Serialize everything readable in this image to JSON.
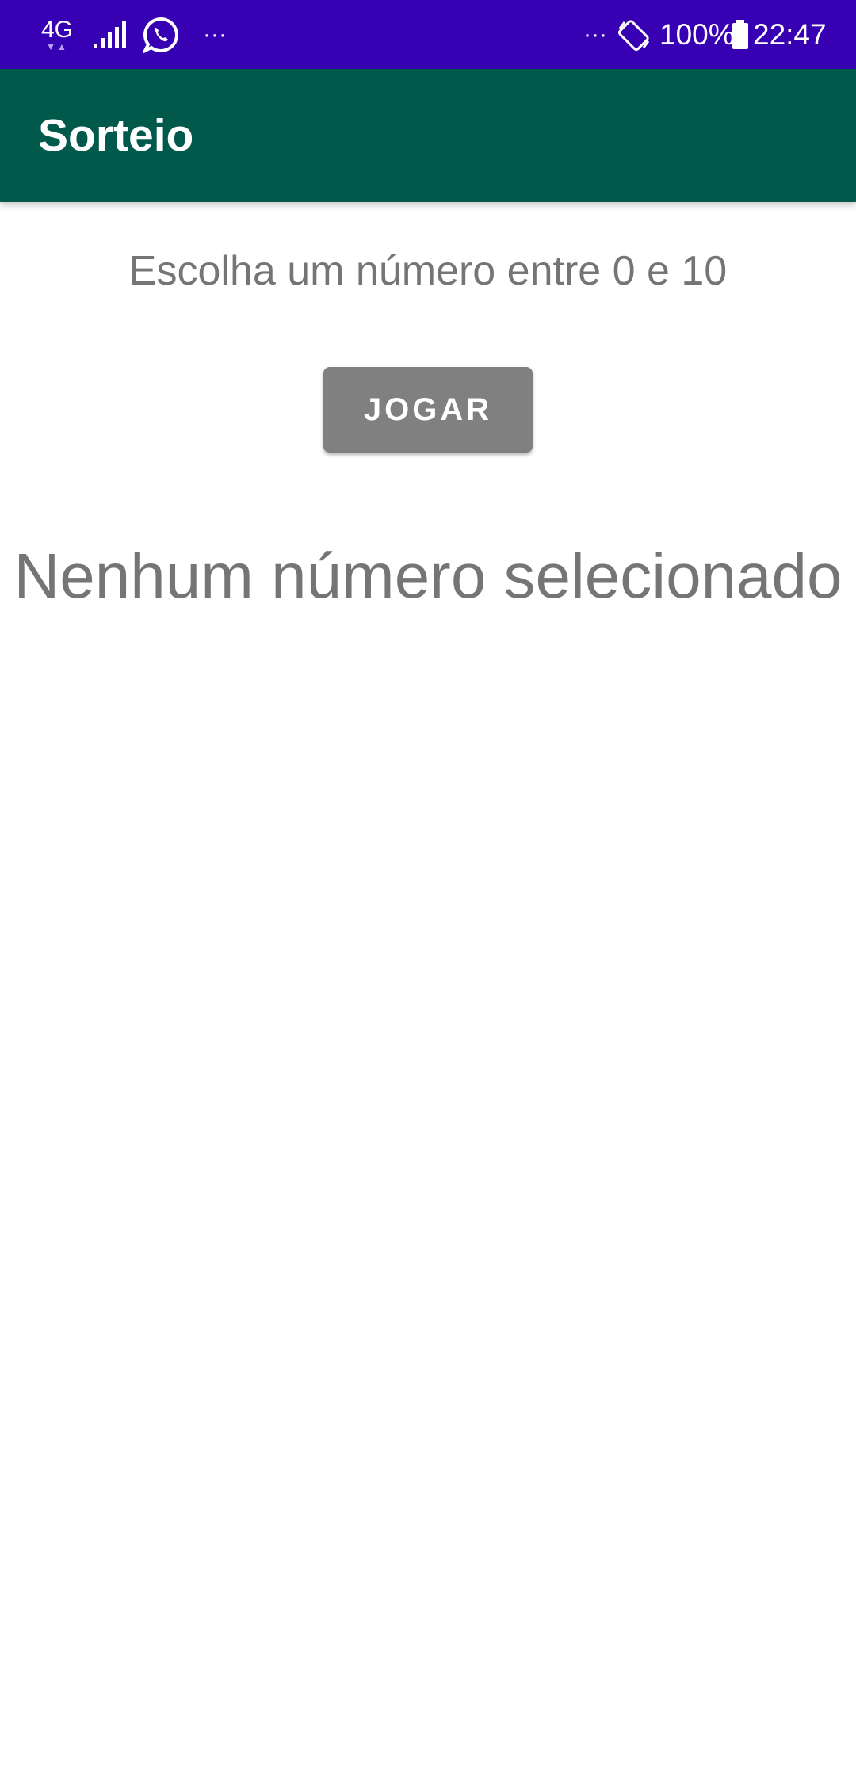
{
  "status_bar": {
    "network_type": "4G",
    "signal_icon": "signal-bars-icon",
    "app_notification_icon": "whatsapp-icon",
    "more_left": "···",
    "more_right": "···",
    "rotate_icon": "auto-rotate-icon",
    "battery_percent": "100%",
    "battery_icon": "battery-full-icon",
    "time": "22:47",
    "background_color": "#3700b3"
  },
  "app_bar": {
    "title": "Sorteio",
    "background_color": "#00594a"
  },
  "main": {
    "prompt": "Escolha um número entre 0 e 10",
    "play_button_label": "JOGAR",
    "play_button_color": "#808080",
    "result_text": "Nenhum número selecionado",
    "text_color": "#757575"
  }
}
